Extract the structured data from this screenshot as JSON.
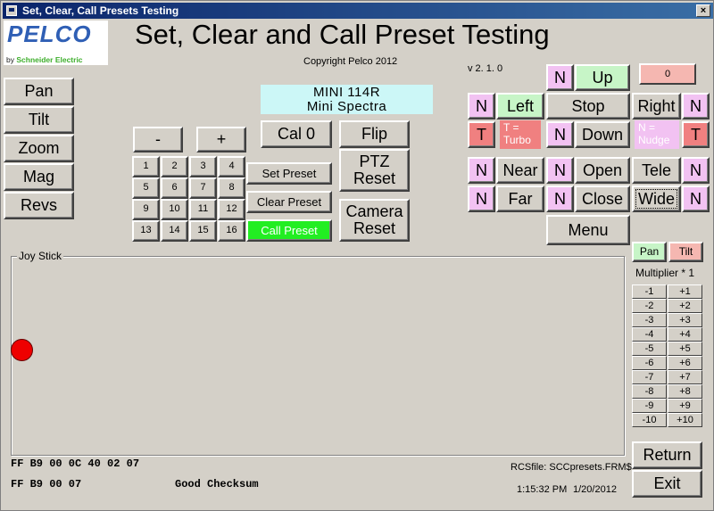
{
  "window": {
    "title": "Set, Clear, Call Presets Testing",
    "close": "×"
  },
  "logo": {
    "brand": "PELCO",
    "by": "by",
    "sub": "Schneider Electric"
  },
  "header": {
    "title": "Set, Clear and Call Preset Testing",
    "copyright": "Copyright Pelco 2012",
    "version": "v 2. 1. 0",
    "counter": "0"
  },
  "left_buttons": [
    "Pan",
    "Tilt",
    "Zoom",
    "Mag",
    "Revs"
  ],
  "device": {
    "model": "MINI 114R",
    "name": "Mini Spectra"
  },
  "steppers": {
    "minus": "-",
    "plus": "+"
  },
  "keypad": [
    "1",
    "2",
    "3",
    "4",
    "5",
    "6",
    "7",
    "8",
    "9",
    "10",
    "11",
    "12",
    "13",
    "14",
    "15",
    "16"
  ],
  "preset_buttons": {
    "set": "Set Preset",
    "clear": "Clear Preset",
    "call": "Call Preset"
  },
  "center_buttons": {
    "cal": "Cal 0",
    "flip": "Flip",
    "ptz_reset_1": "PTZ",
    "ptz_reset_2": "Reset",
    "camera_reset_1": "Camera",
    "camera_reset_2": "Reset"
  },
  "ptz": {
    "n": "N",
    "t": "T",
    "up": "Up",
    "left": "Left",
    "stop": "Stop",
    "right": "Right",
    "down": "Down",
    "turbo_1": "T =",
    "turbo_2": "Turbo",
    "nudge_1": "N =",
    "nudge_2": "Nudge",
    "near": "Near",
    "far": "Far",
    "open": "Open",
    "close": "Close",
    "tele": "Tele",
    "wide": "Wide",
    "menu": "Menu"
  },
  "joystick": {
    "label": "Joy Stick"
  },
  "multiplier": {
    "pan": "Pan",
    "tilt": "Tilt",
    "label": "Multiplier * 1",
    "rows": [
      [
        "-1",
        "+1"
      ],
      [
        "-2",
        "+2"
      ],
      [
        "-3",
        "+3"
      ],
      [
        "-4",
        "+4"
      ],
      [
        "-5",
        "+5"
      ],
      [
        "-6",
        "+6"
      ],
      [
        "-7",
        "+7"
      ],
      [
        "-8",
        "+8"
      ],
      [
        "-9",
        "+9"
      ],
      [
        "-10",
        "+10"
      ]
    ]
  },
  "status": {
    "line1": "FF B9 00 0C 40 02 07",
    "line2": "FF B9 00 07",
    "checksum": "Good Checksum",
    "rcsfile": "RCSfile: SCCpresets.FRM$",
    "time": "1:15:32 PM",
    "date": "1/20/2012"
  },
  "footer_buttons": {
    "return": "Return",
    "exit": "Exit"
  },
  "colors": {
    "titlebar": "#0a246a",
    "pink": "#f2c2f2",
    "green": "#c7f5c7",
    "red": "#f08080",
    "call_preset": "#22ee22",
    "model_box": "#ccf7f7",
    "joystick_dot": "#ee0000"
  }
}
